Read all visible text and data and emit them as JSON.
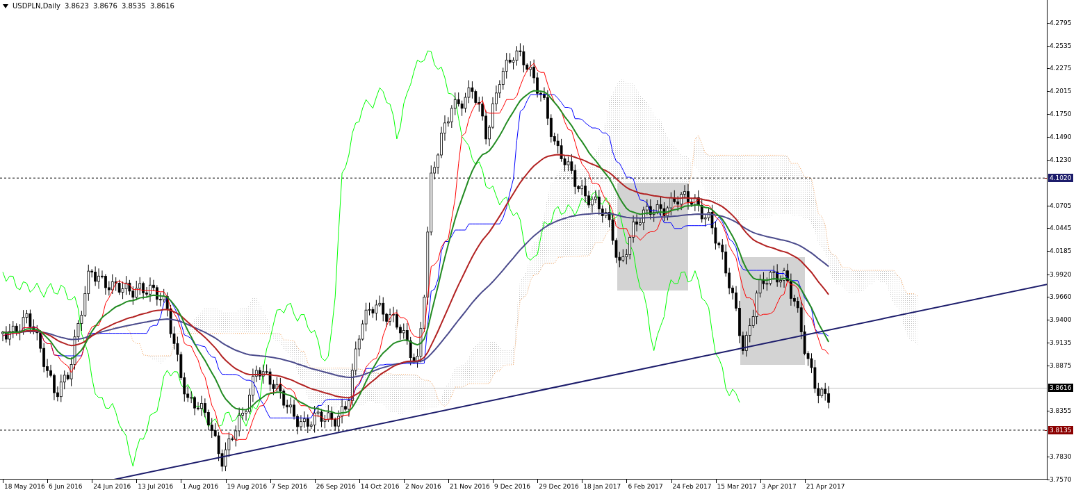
{
  "header": {
    "symbol": "USDPLN,Daily",
    "ohlc": [
      "3.8623",
      "3.8676",
      "3.8535",
      "3.8616"
    ]
  },
  "y_axis": {
    "ticks": [
      "4.2795",
      "4.2535",
      "4.2275",
      "4.2015",
      "4.1750",
      "4.1490",
      "4.1230",
      "4.0705",
      "4.0445",
      "4.0185",
      "3.9920",
      "3.9660",
      "3.9400",
      "3.9135",
      "3.8875",
      "3.8355",
      "3.7830",
      "3.7570"
    ],
    "price_tags": [
      {
        "label": "4.1020",
        "color": "#1c1c6b",
        "kind": "level"
      },
      {
        "label": "3.8616",
        "color": "#000000",
        "kind": "current"
      },
      {
        "label": "3.8135",
        "color": "#8b0000",
        "kind": "level"
      }
    ]
  },
  "x_axis": {
    "labels": [
      "18 May 2016",
      "6 Jun 2016",
      "24 Jun 2016",
      "13 Jul 2016",
      "1 Aug 2016",
      "19 Aug 2016",
      "7 Sep 2016",
      "26 Sep 2016",
      "14 Oct 2016",
      "2 Nov 2016",
      "21 Nov 2016",
      "9 Dec 2016",
      "29 Dec 2016",
      "18 Jan 2017",
      "6 Feb 2017",
      "24 Feb 2017",
      "15 Mar 2017",
      "3 Apr 2017",
      "21 Apr 2017"
    ]
  }
}
